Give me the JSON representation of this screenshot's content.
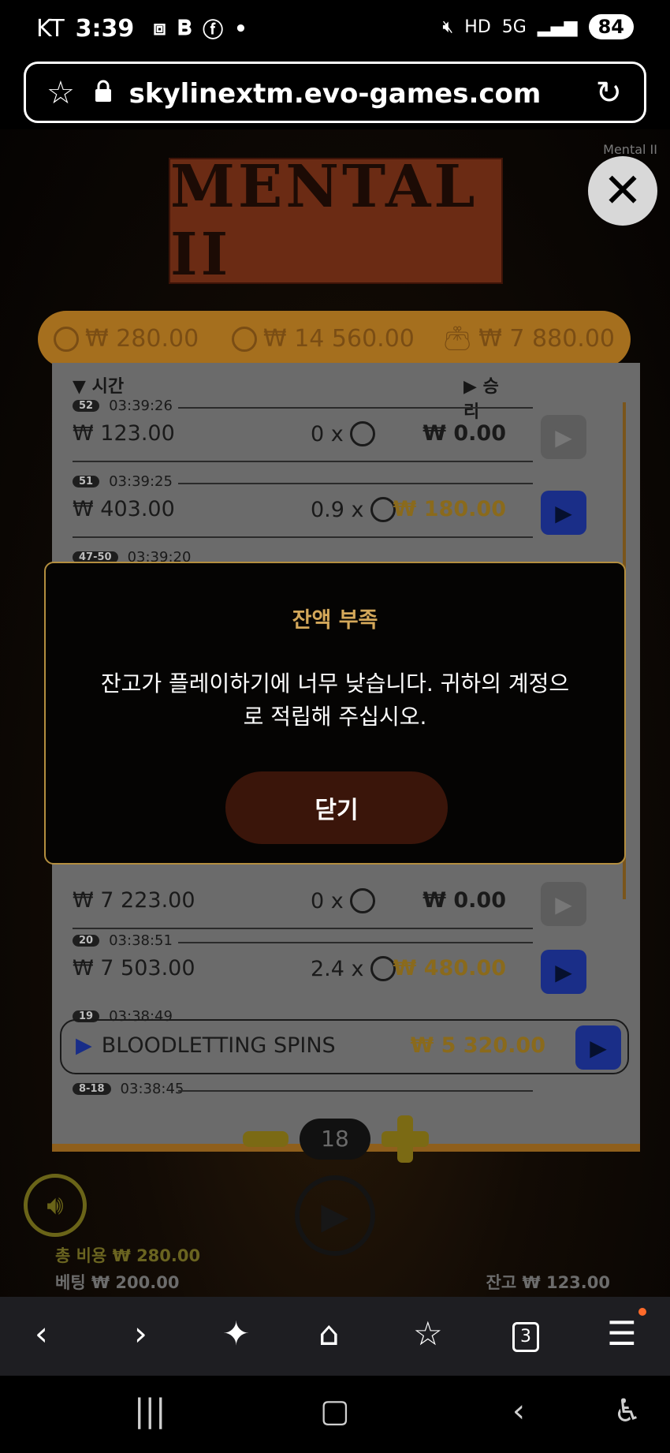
{
  "statusbar": {
    "carrier": "KT",
    "time": "3:39",
    "battery": "84",
    "network": "5G",
    "hd": "HD"
  },
  "browser": {
    "url": "skylinextm.evo-games.com"
  },
  "game": {
    "logo_text": "MENTAL II",
    "corner_label": "Mental II",
    "balance_bar": {
      "cost": "₩ 280.00",
      "max_win": "₩ 14 560.00",
      "wallet": "₩ 7 880.00"
    },
    "history": {
      "header_time": "시간",
      "header_win": "승리",
      "rows": [
        {
          "badge": "52",
          "time": "03:39:26",
          "bet": "₩ 123.00",
          "multiplier": "0 x",
          "win": "₩ 0.00",
          "win_style": "plain",
          "button": "gray"
        },
        {
          "badge": "51",
          "time": "03:39:25",
          "bet": "₩ 403.00",
          "multiplier": "0.9 x",
          "win": "₩ 180.00",
          "win_style": "gold",
          "button": "blue"
        },
        {
          "badge": "47-50",
          "time": "03:39:20",
          "bet": "",
          "multiplier": "",
          "win": "",
          "win_style": "plain",
          "button": "none"
        },
        {
          "badge": "",
          "time": "",
          "bet": "₩ 7 223.00",
          "multiplier": "0 x",
          "win": "₩ 0.00",
          "win_style": "plain",
          "button": "gray"
        },
        {
          "badge": "20",
          "time": "03:38:51",
          "bet": "₩ 7 503.00",
          "multiplier": "2.4 x",
          "win": "₩ 480.00",
          "win_style": "gold",
          "button": "blue"
        }
      ],
      "bonus": {
        "badge": "19",
        "time": "03:38:49",
        "label": "BLOODLETTING SPINS",
        "win": "₩ 5 320.00"
      },
      "last_badge": "8-18",
      "last_time": "03:38:45"
    },
    "stepper_value": "18",
    "footer": {
      "total_cost_label": "총 비용",
      "total_cost_value": "₩ 280.00",
      "bet_label": "베팅",
      "bet_value": "₩ 200.00",
      "balance_label": "잔고",
      "balance_value": "₩ 123.00"
    }
  },
  "modal": {
    "title": "잔액 부족",
    "message_line1": "잔고가 플레이하기에 너무 낮습니다. 귀하의 계정으",
    "message_line2": "로 적립해 주십시오.",
    "button": "닫기"
  },
  "browser_nav": {
    "tab_count": "3"
  },
  "colors": {
    "accent_gold": "#b38e3f",
    "modal_title": "#d4a85a",
    "modal_button_bg": "#3a150a",
    "play_blue": "#1a2e88"
  }
}
